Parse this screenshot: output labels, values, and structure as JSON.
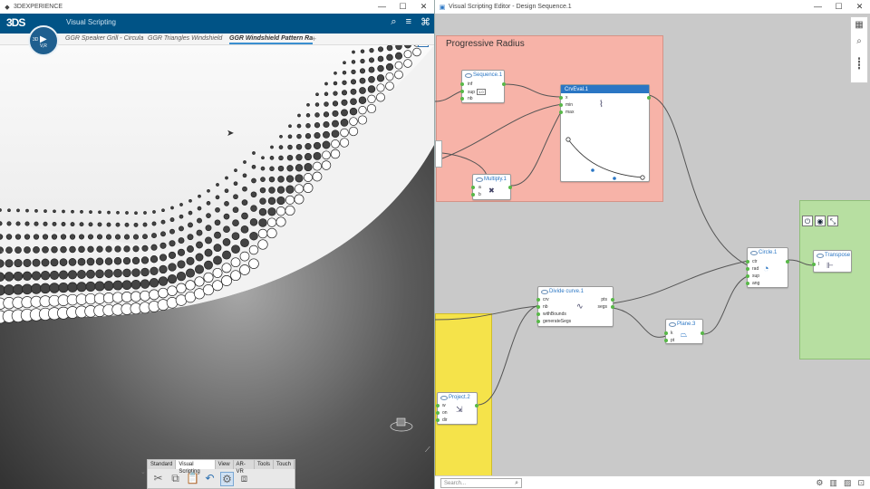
{
  "left_window": {
    "title": "3DEXPERIENCE",
    "app_title": "Visual Scripting",
    "compass": {
      "label_3d": "3D",
      "version": "V,R"
    },
    "logo": "3DS",
    "tabs": [
      {
        "label": "GGR Speaker Grill - Circula",
        "active": false
      },
      {
        "label": "GGR Triangles Windshield",
        "active": false
      },
      {
        "label": "GGR Windshield Pattern Ra",
        "active": true
      }
    ],
    "toolbar_tabs": [
      {
        "label": "Standard",
        "active": false
      },
      {
        "label": "Visual Scripting",
        "active": true
      },
      {
        "label": "View",
        "active": false
      },
      {
        "label": "AR-VR",
        "active": false
      },
      {
        "label": "Tools",
        "active": false
      },
      {
        "label": "Touch",
        "active": false
      }
    ]
  },
  "right_window": {
    "title": "Visual Scripting Editor - Design Sequence.1",
    "groups": {
      "progressive": {
        "title": "Progressive Radius",
        "color": "#f7b3a8"
      }
    },
    "nodes": {
      "sequence": {
        "title": "Sequence.1",
        "ports": [
          "inf",
          "sup",
          "nb"
        ],
        "sup_value": "1.0"
      },
      "crveval": {
        "title": "CrvEval.1",
        "ports": [
          "x",
          "min",
          "max"
        ]
      },
      "multiply": {
        "title": "Multiply.1",
        "ports": [
          "a",
          "b"
        ]
      },
      "divide": {
        "title": "Divide curve.1",
        "inputs": [
          "crv",
          "nb",
          "withBounds",
          "generateSegs"
        ],
        "outputs": [
          "pts",
          "segs"
        ]
      },
      "circle": {
        "title": "Circle.1",
        "ports": [
          "ctr",
          "rad",
          "sup",
          "ang"
        ]
      },
      "transpose": {
        "title": "Transpose",
        "ports": [
          "l"
        ]
      },
      "plane": {
        "title": "Plane.3",
        "ports": [
          "k",
          "pt"
        ]
      },
      "project": {
        "title": "Project.2",
        "ports": [
          "w",
          "on",
          "dir"
        ]
      }
    },
    "search_placeholder": "Search..."
  },
  "colors": {
    "app_blue": "#005386",
    "node_accent": "#2a76c4",
    "port_green": "#58b848",
    "group_red": "#f7b3a8",
    "group_green": "#b7dfa1",
    "group_yellow": "#f5e34a",
    "graph_bg": "#c9c9c9"
  }
}
